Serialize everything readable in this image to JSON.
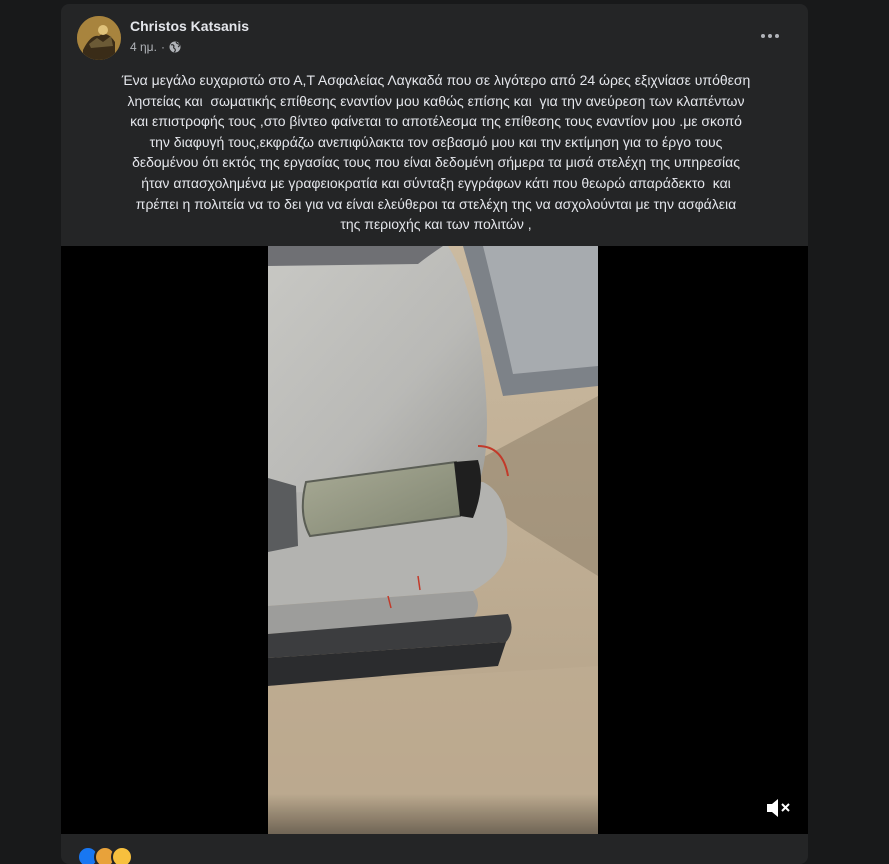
{
  "post": {
    "author": "Christos Katsanis",
    "time": "4 ημ.",
    "separator": "·",
    "privacy_icon": "globe-icon",
    "more_icon": "more-options-icon",
    "text": "Ένα μεγάλο ευχαριστώ στο Α,Τ Ασφαλείας Λαγκαδά που σε λιγότερο από 24 ώρες εξιχνίασε υπόθεση\nληστείας και  σωματικής επίθεσης εναντίον μου καθώς επίσης και  για την ανεύρεση των κλαπέντων\nκαι επιστροφής τους ,στο βίντεο φαίνεται το αποτέλεσμα της επίθεσης τους εναντίον μου .με σκοπό\nτην διαφυγή τους,εκφράζω ανεπιφύλακτα τον σεβασμό μου και την εκτίμηση για το έργο τους\nδεδομένου ότι εκτός της εργασίας τους που είναι δεδομένη σήμερα τα μισά στελέχη της υπηρεσίας\nήταν απασχολημένα με γραφειοκρατία και σύνταξη εγγράφων κάτι που θεωρώ απαράδεκτο  και\nπρέπει η πολιτεία να το δει για να είναι ελεύθεροι τα στελέχη της να ασχολούνται με την ασφάλεια\nτης περιοχής και των πολιτών ,"
  },
  "video": {
    "mute_icon": "muted-speaker-icon"
  },
  "colors": {
    "background": "#18191a",
    "card": "#242526",
    "primary_text": "#e4e6eb",
    "secondary_text": "#b0b3b8"
  }
}
